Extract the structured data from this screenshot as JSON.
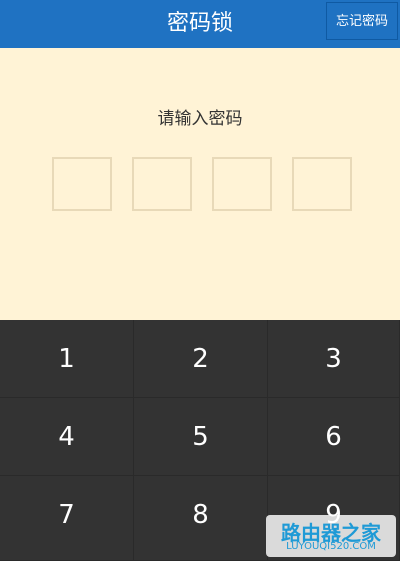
{
  "header": {
    "title": "密码锁",
    "forgot_button": "忘记密码"
  },
  "prompt": "请输入密码",
  "pin_slots": 4,
  "keypad": {
    "keys": [
      "1",
      "2",
      "3",
      "4",
      "5",
      "6",
      "7",
      "8",
      "9"
    ]
  },
  "watermark": {
    "title": "路由器之家",
    "url": "LUYOUQI520.COM"
  },
  "colors": {
    "header_bg": "#1F72C2",
    "screen_bg": "#FFF3D6",
    "keypad_bg": "#333333",
    "key_text": "#FFFFFF"
  }
}
